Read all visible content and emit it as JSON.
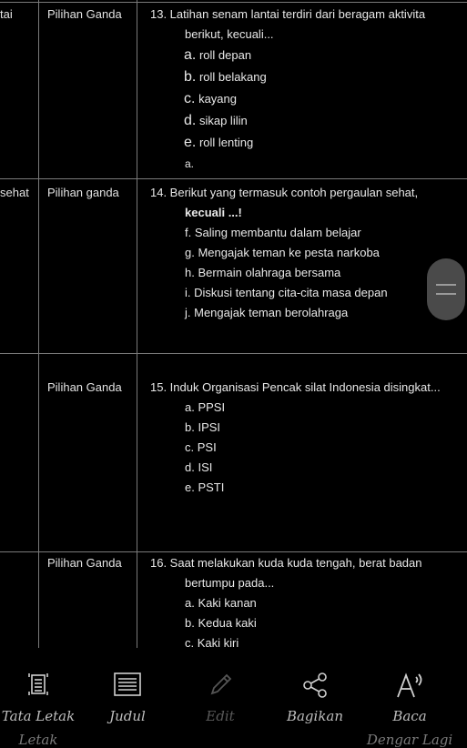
{
  "rows": [
    {
      "category": "tai",
      "type": "Pilihan Ganda"
    },
    {
      "category": "sehat",
      "type": "Pilihan ganda"
    },
    {
      "category": "",
      "type": "Pilihan Ganda"
    },
    {
      "category": "",
      "type": "Pilihan Ganda"
    }
  ],
  "q13": {
    "lines": [
      "13. Latihan senam lantai terdiri dari beragam aktivita",
      "berikut, kecuali..."
    ],
    "options": [
      {
        "letter": "a.",
        "text": "roll depan"
      },
      {
        "letter": "b.",
        "text": "roll belakang"
      },
      {
        "letter": "c.",
        "text": "kayang"
      },
      {
        "letter": "d.",
        "text": "sikap lilin"
      },
      {
        "letter": "e.",
        "text": "roll lenting"
      }
    ],
    "answer": "a."
  },
  "q14": {
    "line1": "14. Berikut yang termasuk contoh pergaulan sehat,",
    "line2": "kecuali ...!",
    "options": [
      "f. Saling membantu dalam belajar",
      "g. Mengajak teman ke pesta narkoba",
      "h. Bermain olahraga bersama",
      "i. Diskusi tentang cita-cita masa depan",
      "j. Mengajak teman berolahraga"
    ]
  },
  "q15": {
    "line1": "15. Induk Organisasi Pencak silat Indonesia disingkat...",
    "options": [
      "a. PPSI",
      "b. IPSI",
      "c. PSI",
      "d. ISI",
      "e. PSTI"
    ]
  },
  "q16": {
    "lines": [
      "16. Saat melakukan kuda kuda tengah, berat badan",
      "bertumpu pada..."
    ],
    "options": [
      "a. Kaki kanan",
      "b. Kedua kaki",
      "c. Kaki kiri"
    ]
  },
  "toolbar": {
    "items": [
      {
        "label": "Tata Letak",
        "label2": "Letak",
        "icon": "layout-icon"
      },
      {
        "label": "Judul",
        "icon": "heading-list-icon"
      },
      {
        "label": "Edit",
        "icon": "pencil-icon"
      },
      {
        "label": "Bagikan",
        "icon": "share-icon"
      },
      {
        "label": "Baca",
        "label2": "Dengar Lagi",
        "icon": "read-aloud-icon"
      }
    ]
  },
  "colors": {
    "background": "#000000",
    "text": "#e6e6e6",
    "grid": "#7a7a7a",
    "disabled": "#5a5a5a"
  }
}
